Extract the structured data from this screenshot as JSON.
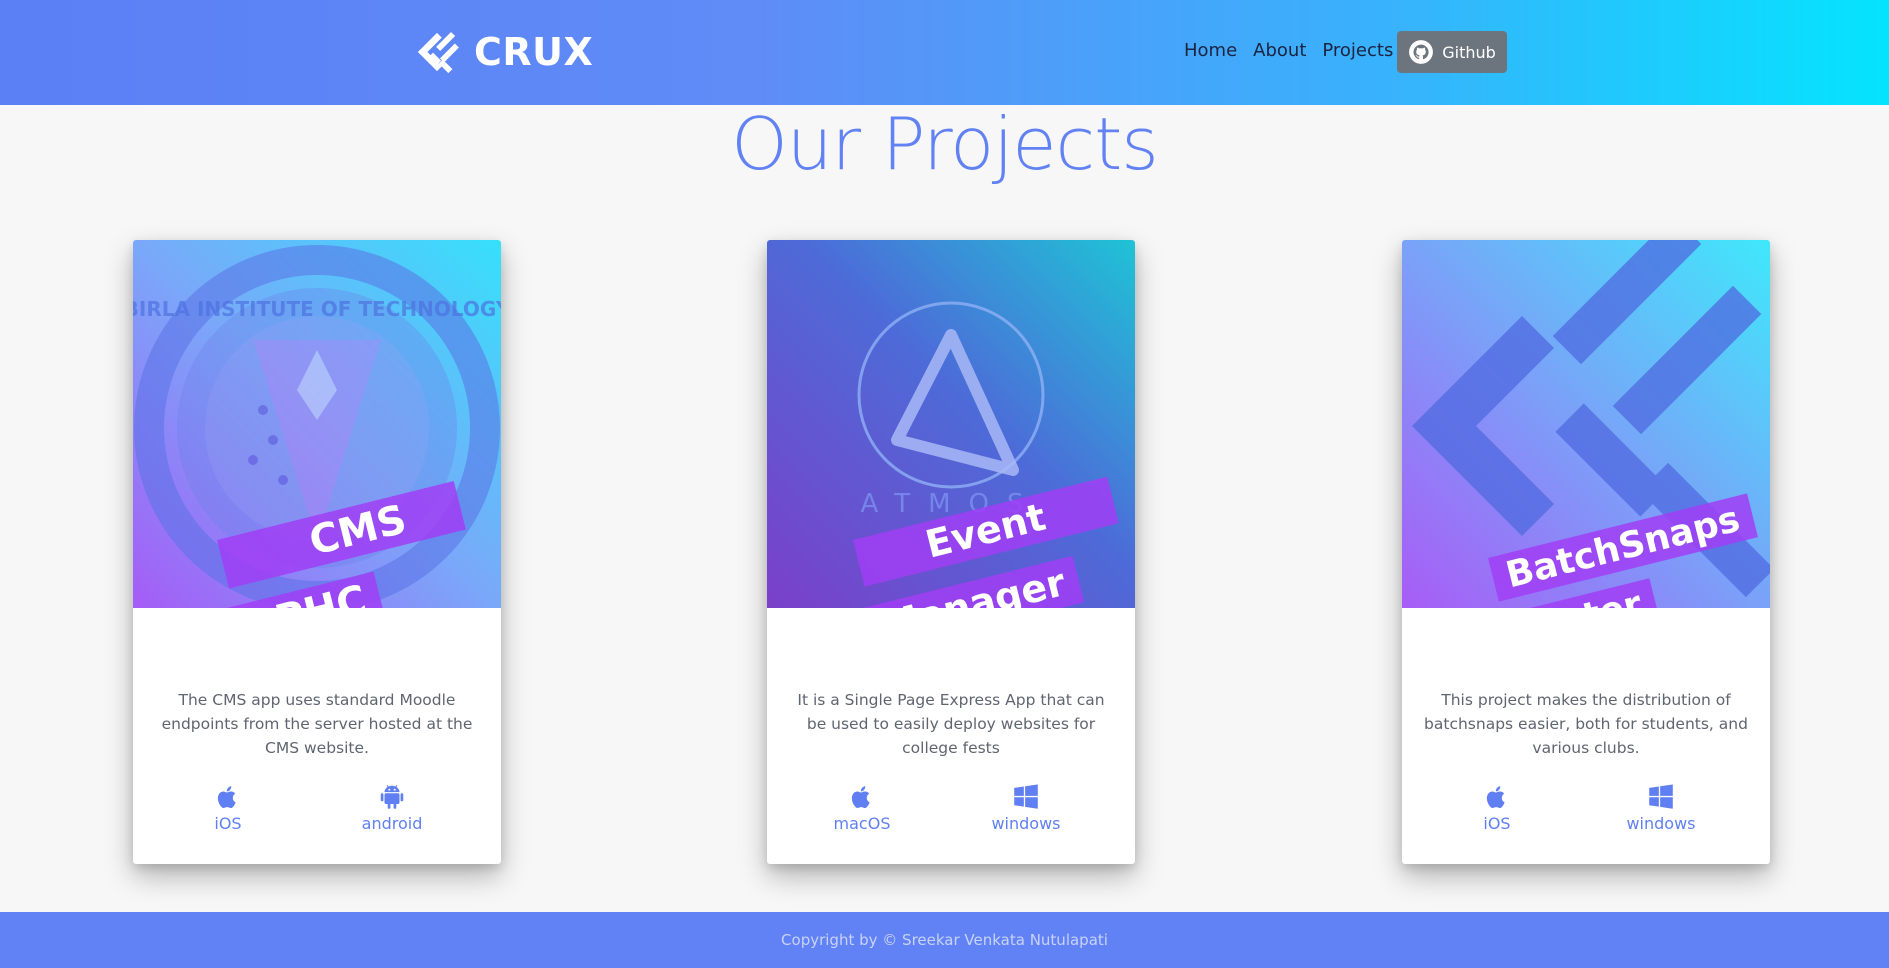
{
  "header": {
    "brand_name": "CRUX",
    "nav": [
      "Home",
      "About",
      "Projects"
    ],
    "github_label": "Github"
  },
  "page_title": "Our Projects",
  "cards": [
    {
      "ribbon_lines": [
        "CMS",
        "BPHC"
      ],
      "description": "The CMS app uses standard Moodle endpoints from the server hosted at the CMS website.",
      "platforms": [
        {
          "label": "iOS",
          "icon": "apple-icon"
        },
        {
          "label": "android",
          "icon": "android-icon"
        }
      ],
      "image": {
        "theme": "bits-pilani-seal",
        "colors": [
          "#36e0fb",
          "#7aa8f9",
          "#a55cf6"
        ]
      }
    },
    {
      "ribbon_lines": [
        "Event",
        "Manager"
      ],
      "description": "It is a Single Page Express App that can be used to easily deploy websites for college fests",
      "platforms": [
        {
          "label": "macOS",
          "icon": "apple-icon"
        },
        {
          "label": "windows",
          "icon": "windows-icon"
        }
      ],
      "image": {
        "theme": "atmos-logo",
        "colors": [
          "#1fc3d6",
          "#4d6bd8",
          "#7b3fc8"
        ]
      }
    },
    {
      "ribbon_lines": [
        "BatchSnaps",
        "Sorter"
      ],
      "description": "This project makes the distribution of batchsnaps easier, both for students, and various clubs.",
      "platforms": [
        {
          "label": "iOS",
          "icon": "apple-icon"
        },
        {
          "label": "windows",
          "icon": "windows-icon"
        }
      ],
      "image": {
        "theme": "crux-logo",
        "colors": [
          "#3fe8fb",
          "#7aa2f8",
          "#a85cf6"
        ]
      }
    }
  ],
  "footer_text": "Copyright by © Sreekar Venkata Nutulapati",
  "colors": {
    "accent": "#6282f4",
    "header_gradient_start": "#5b7ff5",
    "header_gradient_end": "#04e4fe",
    "ribbon": "#a03ef5",
    "github_button": "#6c757d",
    "footer": "#6082f4"
  }
}
